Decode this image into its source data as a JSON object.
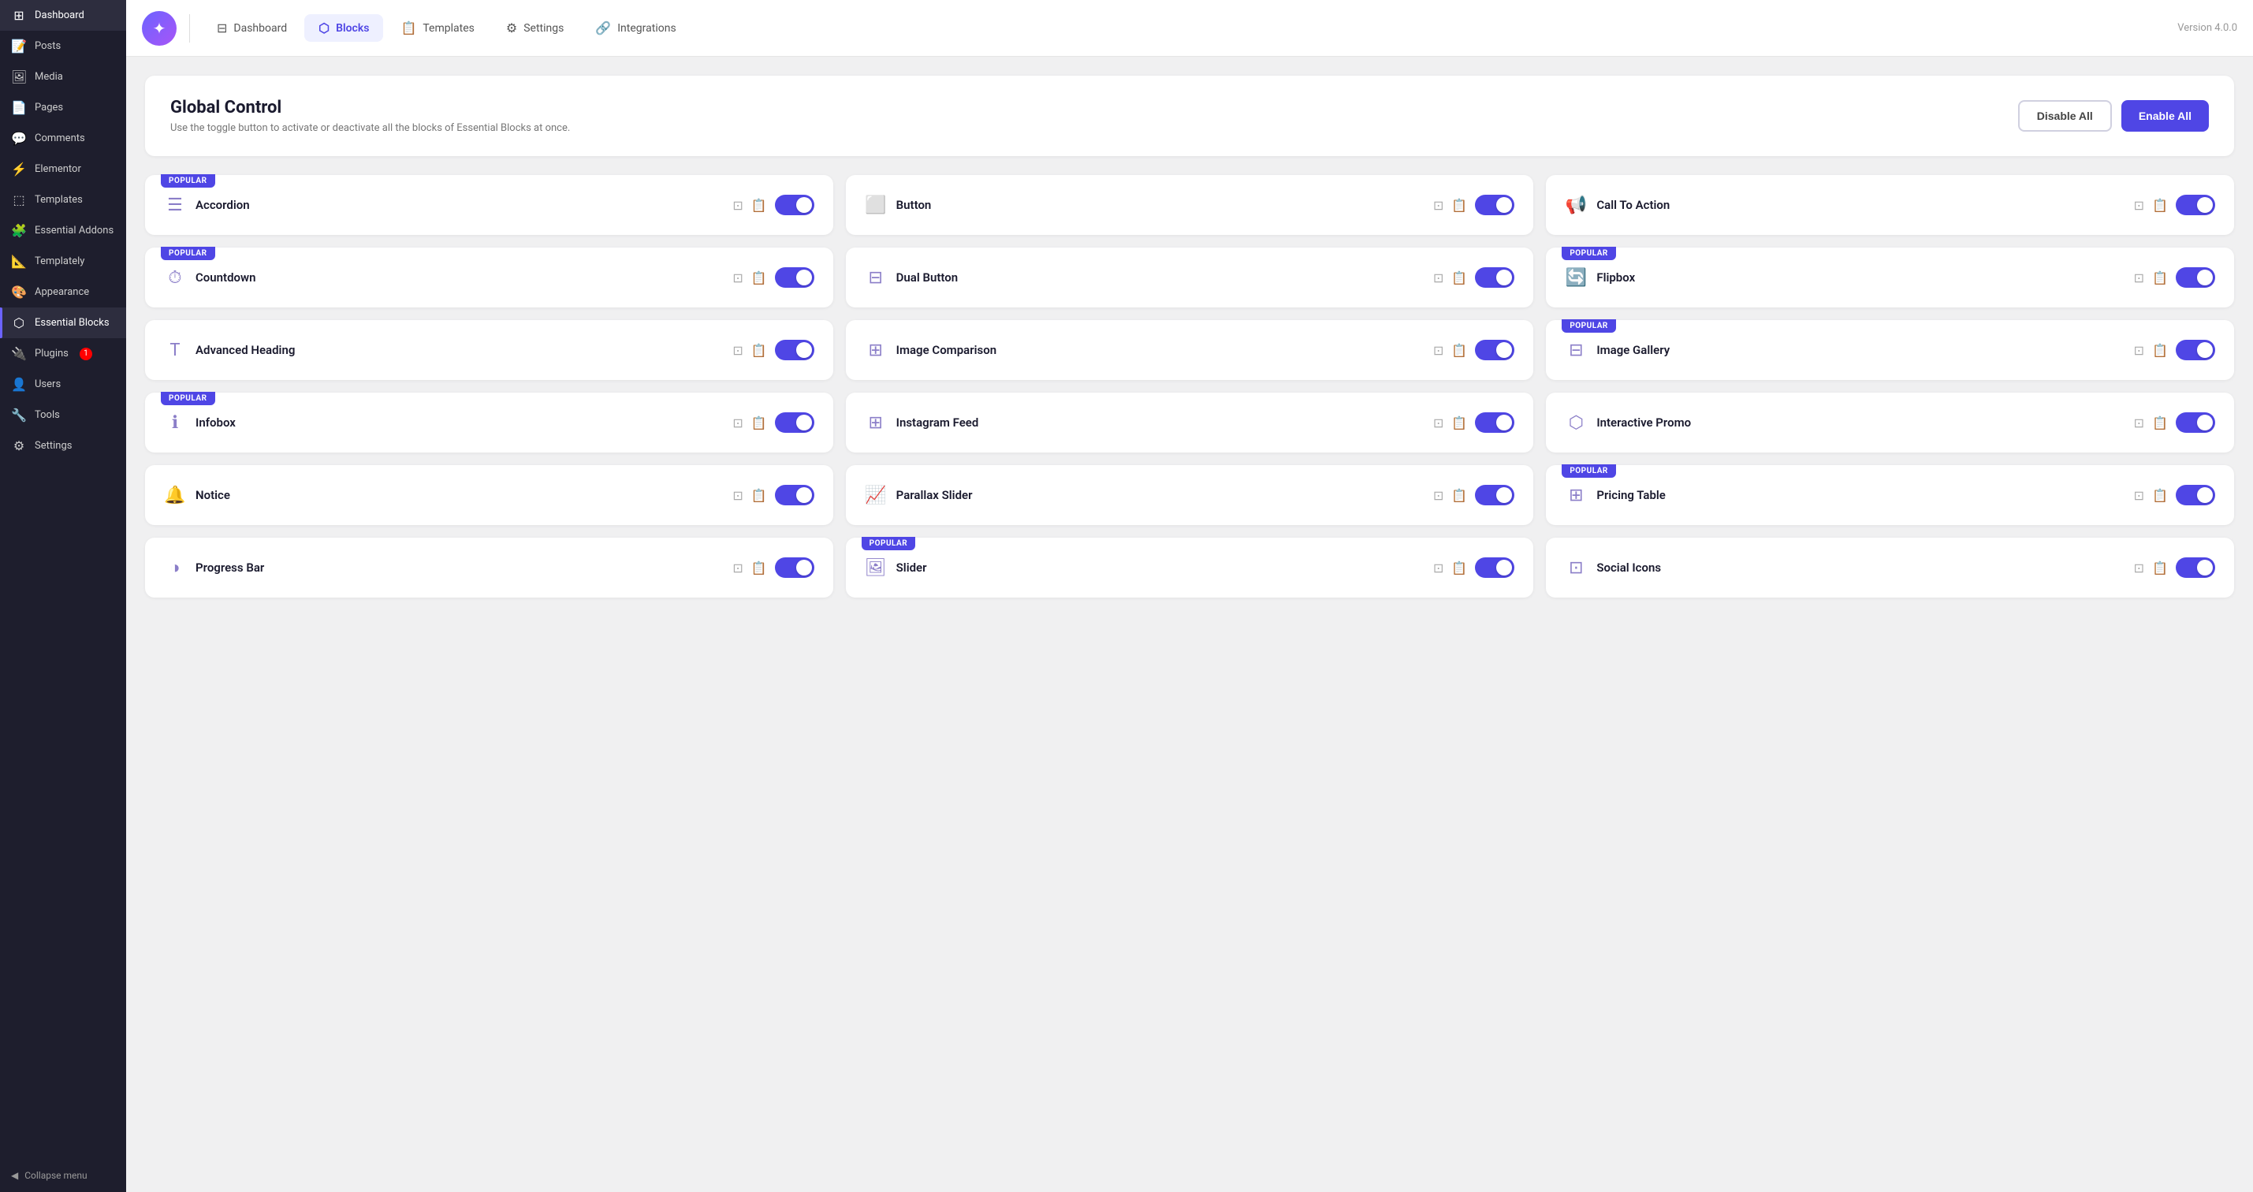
{
  "sidebar": {
    "items": [
      {
        "id": "dashboard",
        "label": "Dashboard",
        "icon": "⊞"
      },
      {
        "id": "posts",
        "label": "Posts",
        "icon": "📝"
      },
      {
        "id": "media",
        "label": "Media",
        "icon": "🖼"
      },
      {
        "id": "pages",
        "label": "Pages",
        "icon": "📄"
      },
      {
        "id": "comments",
        "label": "Comments",
        "icon": "💬"
      },
      {
        "id": "elementor",
        "label": "Elementor",
        "icon": "⚡"
      },
      {
        "id": "templates",
        "label": "Templates",
        "icon": "⬚"
      },
      {
        "id": "essential-addons",
        "label": "Essential Addons",
        "icon": "🧩"
      },
      {
        "id": "templately",
        "label": "Templately",
        "icon": "📐"
      },
      {
        "id": "appearance",
        "label": "Appearance",
        "icon": "🎨"
      },
      {
        "id": "essential-blocks",
        "label": "Essential Blocks",
        "icon": "⬡",
        "active": true
      },
      {
        "id": "plugins",
        "label": "Plugins",
        "icon": "🔌",
        "badge": "1"
      },
      {
        "id": "users",
        "label": "Users",
        "icon": "👤"
      },
      {
        "id": "tools",
        "label": "Tools",
        "icon": "🔧"
      },
      {
        "id": "settings",
        "label": "Settings",
        "icon": "⚙"
      }
    ],
    "collapse_label": "Collapse menu"
  },
  "topnav": {
    "tabs": [
      {
        "id": "dashboard",
        "label": "Dashboard",
        "icon": "⊟",
        "active": false
      },
      {
        "id": "blocks",
        "label": "Blocks",
        "icon": "⬡",
        "active": true
      },
      {
        "id": "templates",
        "label": "Templates",
        "icon": "📋",
        "active": false
      },
      {
        "id": "settings",
        "label": "Settings",
        "icon": "⚙",
        "active": false
      },
      {
        "id": "integrations",
        "label": "Integrations",
        "icon": "🔗",
        "active": false
      }
    ],
    "version": "Version 4.0.0"
  },
  "global_control": {
    "title": "Global Control",
    "description": "Use the toggle button to activate or deactivate all the blocks of Essential Blocks at once.",
    "disable_all": "Disable All",
    "enable_all": "Enable All"
  },
  "blocks": [
    {
      "id": "accordion",
      "name": "Accordion",
      "icon": "☰",
      "popular": true,
      "enabled": true
    },
    {
      "id": "button",
      "name": "Button",
      "icon": "⬜",
      "popular": false,
      "enabled": true
    },
    {
      "id": "call-to-action",
      "name": "Call To Action",
      "icon": "📢",
      "popular": false,
      "enabled": true
    },
    {
      "id": "countdown",
      "name": "Countdown",
      "icon": "⏱",
      "popular": true,
      "enabled": true
    },
    {
      "id": "dual-button",
      "name": "Dual Button",
      "icon": "⊟",
      "popular": false,
      "enabled": true
    },
    {
      "id": "flipbox",
      "name": "Flipbox",
      "icon": "🔄",
      "popular": true,
      "enabled": true
    },
    {
      "id": "advanced-heading",
      "name": "Advanced Heading",
      "icon": "T",
      "popular": false,
      "enabled": true
    },
    {
      "id": "image-comparison",
      "name": "Image Comparison",
      "icon": "⊞",
      "popular": false,
      "enabled": true
    },
    {
      "id": "image-gallery",
      "name": "Image Gallery",
      "icon": "⊟",
      "popular": true,
      "enabled": true
    },
    {
      "id": "infobox",
      "name": "Infobox",
      "icon": "ℹ",
      "popular": true,
      "enabled": true
    },
    {
      "id": "instagram-feed",
      "name": "Instagram Feed",
      "icon": "⊞",
      "popular": false,
      "enabled": true
    },
    {
      "id": "interactive-promo",
      "name": "Interactive Promo",
      "icon": "⬡",
      "popular": false,
      "enabled": true
    },
    {
      "id": "notice",
      "name": "Notice",
      "icon": "🔔",
      "popular": false,
      "enabled": true
    },
    {
      "id": "parallax-slider",
      "name": "Parallax Slider",
      "icon": "📈",
      "popular": false,
      "enabled": true
    },
    {
      "id": "pricing-table",
      "name": "Pricing Table",
      "icon": "⊞",
      "popular": true,
      "enabled": true
    },
    {
      "id": "progress-bar",
      "name": "Progress Bar",
      "icon": "◑",
      "popular": false,
      "enabled": true
    },
    {
      "id": "slider",
      "name": "Slider",
      "icon": "🖼",
      "popular": true,
      "enabled": true
    },
    {
      "id": "social-icons",
      "name": "Social Icons",
      "icon": "⊡",
      "popular": false,
      "enabled": true
    }
  ]
}
